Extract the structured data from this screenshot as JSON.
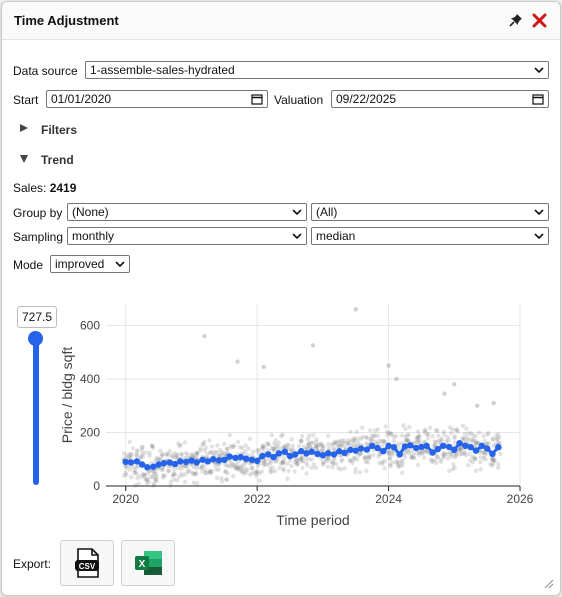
{
  "window": {
    "title": "Time Adjustment"
  },
  "form": {
    "data_source_label": "Data source",
    "data_source_value": "1-assemble-sales-hydrated",
    "start_label": "Start",
    "start_value": "01/01/2020",
    "valuation_label": "Valuation",
    "valuation_value": "09/22/2025"
  },
  "sections": {
    "filters": "Filters",
    "trend": "Trend"
  },
  "sales": {
    "label": "Sales:",
    "count": "2419"
  },
  "group_by": {
    "label": "Group by",
    "value": "(None)",
    "value2": "(All)"
  },
  "sampling": {
    "label": "Sampling",
    "value": "monthly",
    "stat": "median"
  },
  "mode": {
    "label": "Mode",
    "value": "improved"
  },
  "slider": {
    "value": "727.5"
  },
  "export": {
    "label": "Export:",
    "buttons": [
      "csv",
      "excel"
    ]
  },
  "chart_data": {
    "type": "scatter",
    "xlabel": "Time period",
    "ylabel": "Price / bldg sqft",
    "xlim": [
      2019.7,
      2026
    ],
    "ylim": [
      0,
      680
    ],
    "xticks": [
      "2020",
      "2022",
      "2024",
      "2026"
    ],
    "yticks": [
      "0",
      "200",
      "400",
      "600"
    ],
    "grid": true,
    "colors": {
      "trend": "#2563eb",
      "points": "#7a7a7a"
    },
    "outliers": [
      {
        "x": 2021.2,
        "y": 560
      },
      {
        "x": 2021.7,
        "y": 465
      },
      {
        "x": 2022.1,
        "y": 445
      },
      {
        "x": 2022.85,
        "y": 525
      },
      {
        "x": 2023.5,
        "y": 660
      },
      {
        "x": 2024.0,
        "y": 450
      },
      {
        "x": 2024.12,
        "y": 400
      },
      {
        "x": 2024.85,
        "y": 345
      },
      {
        "x": 2025.0,
        "y": 380
      },
      {
        "x": 2025.35,
        "y": 300
      },
      {
        "x": 2025.6,
        "y": 310
      },
      {
        "x": 2020.4,
        "y": 150
      }
    ],
    "trend": [
      {
        "x": 2020.0,
        "y": 90
      },
      {
        "x": 2020.08,
        "y": 88
      },
      {
        "x": 2020.17,
        "y": 92
      },
      {
        "x": 2020.25,
        "y": 80
      },
      {
        "x": 2020.33,
        "y": 70
      },
      {
        "x": 2020.42,
        "y": 72
      },
      {
        "x": 2020.5,
        "y": 80
      },
      {
        "x": 2020.58,
        "y": 85
      },
      {
        "x": 2020.67,
        "y": 88
      },
      {
        "x": 2020.75,
        "y": 82
      },
      {
        "x": 2020.83,
        "y": 92
      },
      {
        "x": 2020.92,
        "y": 90
      },
      {
        "x": 2021.0,
        "y": 95
      },
      {
        "x": 2021.08,
        "y": 88
      },
      {
        "x": 2021.17,
        "y": 98
      },
      {
        "x": 2021.25,
        "y": 92
      },
      {
        "x": 2021.33,
        "y": 100
      },
      {
        "x": 2021.42,
        "y": 96
      },
      {
        "x": 2021.5,
        "y": 98
      },
      {
        "x": 2021.58,
        "y": 110
      },
      {
        "x": 2021.67,
        "y": 105
      },
      {
        "x": 2021.75,
        "y": 108
      },
      {
        "x": 2021.83,
        "y": 102
      },
      {
        "x": 2021.92,
        "y": 98
      },
      {
        "x": 2022.0,
        "y": 94
      },
      {
        "x": 2022.08,
        "y": 112
      },
      {
        "x": 2022.17,
        "y": 118
      },
      {
        "x": 2022.25,
        "y": 108
      },
      {
        "x": 2022.33,
        "y": 122
      },
      {
        "x": 2022.42,
        "y": 128
      },
      {
        "x": 2022.5,
        "y": 112
      },
      {
        "x": 2022.58,
        "y": 118
      },
      {
        "x": 2022.67,
        "y": 130
      },
      {
        "x": 2022.75,
        "y": 122
      },
      {
        "x": 2022.83,
        "y": 128
      },
      {
        "x": 2022.92,
        "y": 120
      },
      {
        "x": 2023.0,
        "y": 115
      },
      {
        "x": 2023.08,
        "y": 122
      },
      {
        "x": 2023.17,
        "y": 118
      },
      {
        "x": 2023.25,
        "y": 130
      },
      {
        "x": 2023.33,
        "y": 124
      },
      {
        "x": 2023.42,
        "y": 135
      },
      {
        "x": 2023.5,
        "y": 132
      },
      {
        "x": 2023.58,
        "y": 140
      },
      {
        "x": 2023.67,
        "y": 136
      },
      {
        "x": 2023.75,
        "y": 150
      },
      {
        "x": 2023.83,
        "y": 142
      },
      {
        "x": 2023.92,
        "y": 130
      },
      {
        "x": 2024.0,
        "y": 150
      },
      {
        "x": 2024.08,
        "y": 145
      },
      {
        "x": 2024.17,
        "y": 118
      },
      {
        "x": 2024.25,
        "y": 148
      },
      {
        "x": 2024.33,
        "y": 152
      },
      {
        "x": 2024.42,
        "y": 142
      },
      {
        "x": 2024.5,
        "y": 146
      },
      {
        "x": 2024.58,
        "y": 150
      },
      {
        "x": 2024.67,
        "y": 125
      },
      {
        "x": 2024.75,
        "y": 138
      },
      {
        "x": 2024.83,
        "y": 150
      },
      {
        "x": 2024.92,
        "y": 146
      },
      {
        "x": 2025.0,
        "y": 135
      },
      {
        "x": 2025.08,
        "y": 160
      },
      {
        "x": 2025.17,
        "y": 150
      },
      {
        "x": 2025.25,
        "y": 145
      },
      {
        "x": 2025.33,
        "y": 132
      },
      {
        "x": 2025.42,
        "y": 150
      },
      {
        "x": 2025.5,
        "y": 140
      },
      {
        "x": 2025.58,
        "y": 120
      },
      {
        "x": 2025.67,
        "y": 145
      }
    ]
  }
}
